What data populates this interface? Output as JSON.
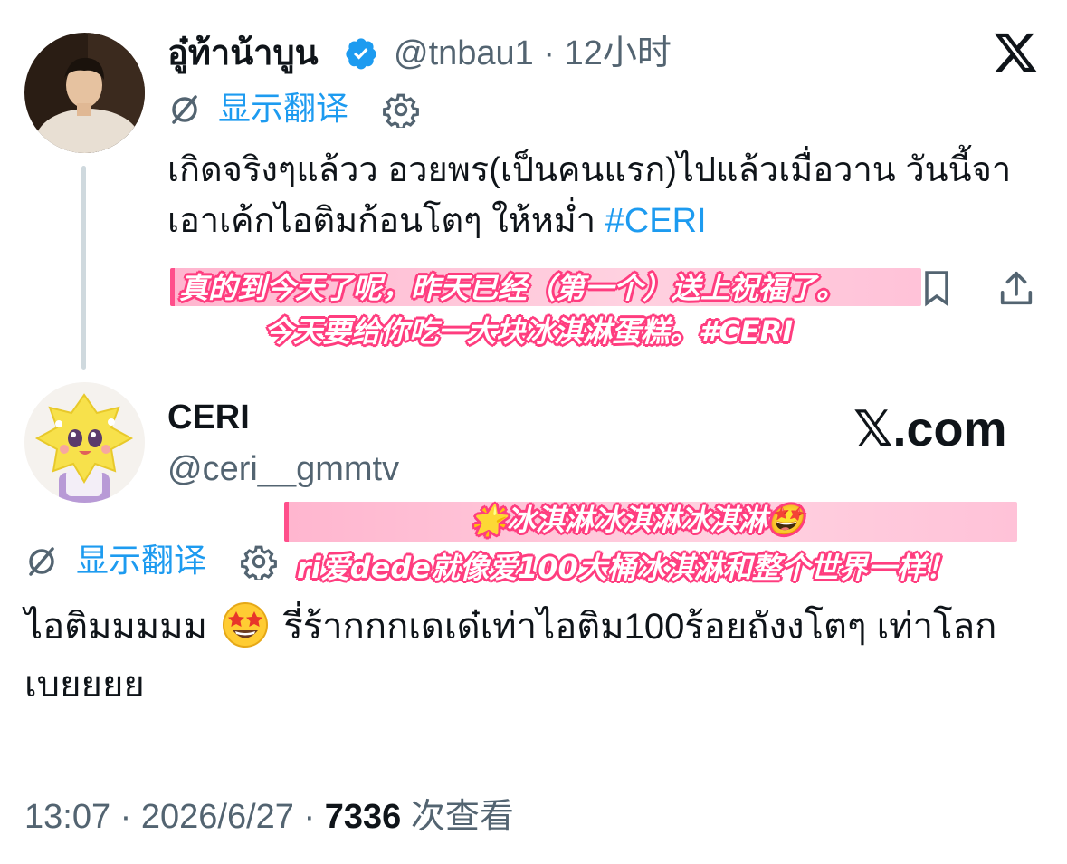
{
  "tweet": {
    "author_name": "อู๋ท้าน้าบูน",
    "verified": true,
    "handle": "@tnbau1",
    "separator": "·",
    "time_ago": "12小时",
    "translate_label": "显示翻译",
    "text_main": "เกิดจริงๆแล้วว อวยพร(เป็นคนแรก)ไปแล้วเมื่อวาน วันนี้จาเอาเค้กไอติมก้อนโตๆ ให้หม่ำ ",
    "hashtag": "#CERI",
    "icons": [
      "verified-badge-icon",
      "x-logo-icon",
      "translate-icon",
      "gear-icon",
      "bookmark-icon",
      "share-icon"
    ]
  },
  "caption1": {
    "line1": "真的到今天了呢，昨天已经（第一个）送上祝福了。",
    "line2": "今天要给你吃一大块冰淇淋蛋糕。#CERI"
  },
  "reply": {
    "author_name": "CERI",
    "handle": "@ceri__gmmtv",
    "watermark": "𝕏.com",
    "translate_label": "显示翻译",
    "text_part1": "ไอติมมมมม",
    "text_part2": "รี่ร้ากกกเดเด๋เท่าไอติม100ร้อยถังงโตๆ เท่าโลกเบยยยย",
    "timestamp": "13:07",
    "date": "2026/6/27",
    "separator": "·",
    "views": "7336",
    "views_label": "次查看",
    "emoji": "star-struck-emoji"
  },
  "caption2": {
    "line1": "🌟冰淇淋冰淇淋冰淇淋🤩",
    "line2": "ri爱dede就像爱100大桶冰淇淋和整个世界一样！"
  },
  "colors": {
    "link_blue": "#1d9bf0",
    "secondary_text": "#536471",
    "caption_pink": "#ff3d7f",
    "thread_line": "#cfd9de"
  }
}
